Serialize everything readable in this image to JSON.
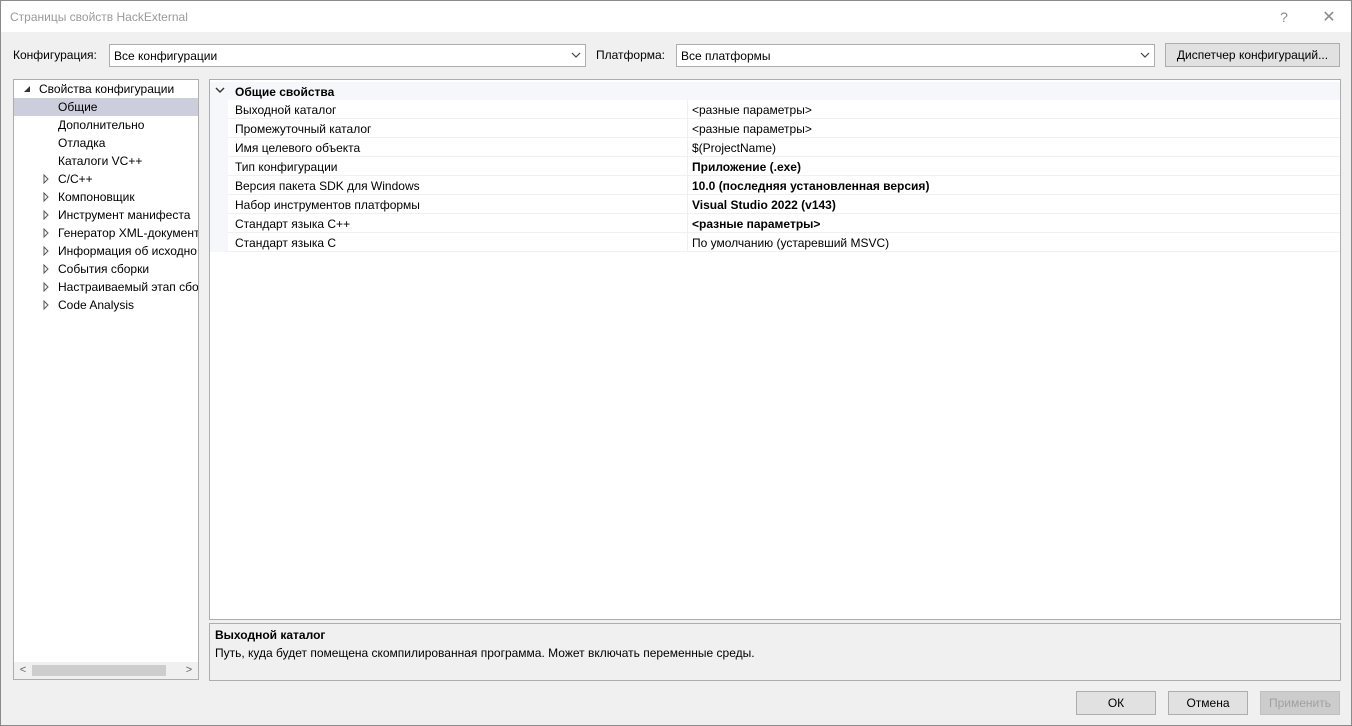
{
  "window": {
    "title": "Страницы свойств HackExternal",
    "help_glyph": "?",
    "close_glyph": "✕"
  },
  "config_bar": {
    "configuration_label": "Конфигурация:",
    "configuration_value": "Все конфигурации",
    "platform_label": "Платформа:",
    "platform_value": "Все платформы",
    "manager_button": "Диспетчер конфигураций..."
  },
  "tree": {
    "items": [
      {
        "label": "Свойства конфигурации",
        "expander": "expanded"
      },
      {
        "label": "Общие",
        "expander": "none",
        "selected": true
      },
      {
        "label": "Дополнительно",
        "expander": "none"
      },
      {
        "label": "Отладка",
        "expander": "none"
      },
      {
        "label": "Каталоги VC++",
        "expander": "none"
      },
      {
        "label": "C/C++",
        "expander": "collapsed"
      },
      {
        "label": "Компоновщик",
        "expander": "collapsed"
      },
      {
        "label": "Инструмент манифеста",
        "expander": "collapsed"
      },
      {
        "label": "Генератор XML-документ",
        "expander": "collapsed"
      },
      {
        "label": "Информация об исходно",
        "expander": "collapsed"
      },
      {
        "label": "События сборки",
        "expander": "collapsed"
      },
      {
        "label": "Настраиваемый этап сбо",
        "expander": "collapsed"
      },
      {
        "label": "Code Analysis",
        "expander": "collapsed"
      }
    ],
    "scroll_left": "<",
    "scroll_right": ">"
  },
  "grid": {
    "category": "Общие свойства",
    "rows": [
      {
        "name": "Выходной каталог",
        "value": "<разные параметры>",
        "bold": false
      },
      {
        "name": "Промежуточный каталог",
        "value": "<разные параметры>",
        "bold": false
      },
      {
        "name": "Имя целевого объекта",
        "value": "$(ProjectName)",
        "bold": false
      },
      {
        "name": "Тип конфигурации",
        "value": "Приложение (.exe)",
        "bold": true
      },
      {
        "name": "Версия пакета SDK для Windows",
        "value": "10.0 (последняя установленная версия)",
        "bold": true
      },
      {
        "name": "Набор инструментов платформы",
        "value": "Visual Studio 2022 (v143)",
        "bold": true
      },
      {
        "name": "Стандарт языка C++",
        "value": "<разные параметры>",
        "bold": true
      },
      {
        "name": "Стандарт языка C",
        "value": "По умолчанию (устаревший MSVC)",
        "bold": false
      }
    ]
  },
  "description": {
    "title": "Выходной каталог",
    "text": "Путь, куда будет помещена скомпилированная программа. Может включать переменные среды."
  },
  "buttons": {
    "ok": "ОК",
    "cancel": "Отмена",
    "apply": "Применить"
  },
  "colors": {
    "selection": "#cccedb",
    "border": "#adadad",
    "button_face": "#e1e1e1"
  }
}
